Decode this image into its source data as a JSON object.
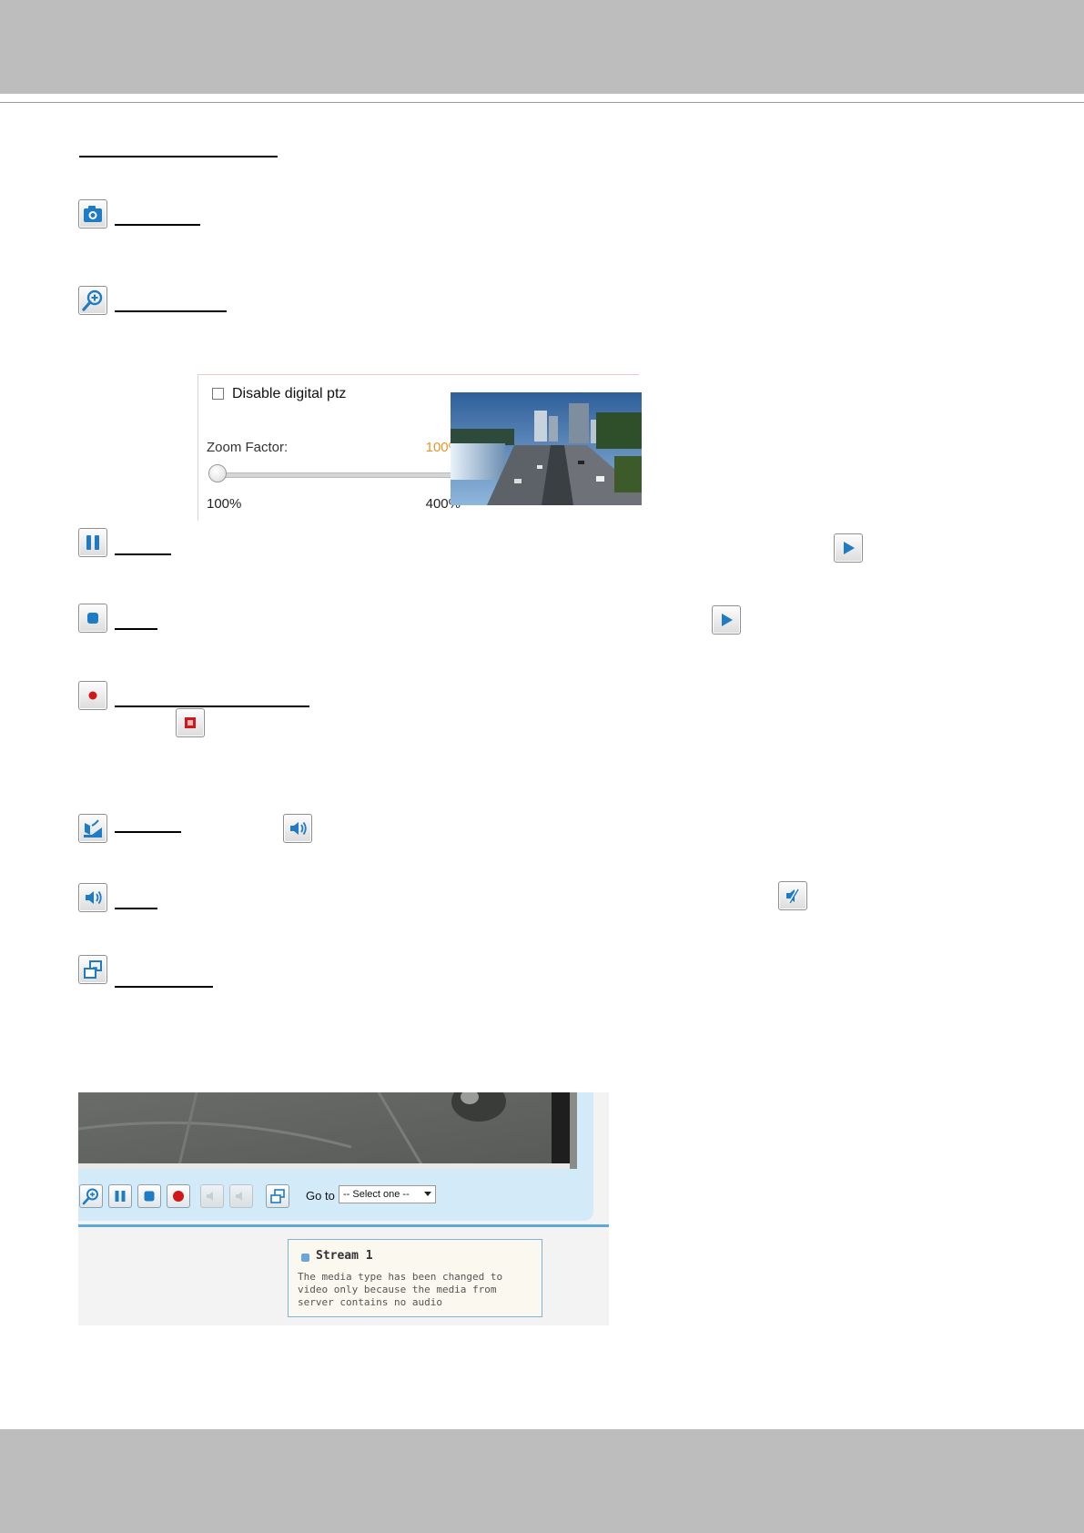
{
  "colors": {
    "header_gray": "#bdbdbd",
    "accent_orange": "#e8942a",
    "icon_blue": "#1e7bc4",
    "record_red": "#d01818",
    "panel_blue": "#d3ebf8"
  },
  "icons": {
    "snapshot": "camera-icon",
    "digital_zoom": "zoom-in-icon",
    "pause": "pause-icon",
    "play": "play-icon",
    "stop": "stop-icon",
    "record": "record-icon",
    "stop_record": "stop-record-icon",
    "volume": "volume-icon",
    "mute": "mute-icon",
    "talk": "talk-icon",
    "fullscreen": "fullscreen-icon"
  },
  "zoom_panel": {
    "checkbox_label": "Disable digital ptz",
    "zoom_factor_label": "Zoom Factor:",
    "zoom_factor_value": "100%",
    "slider_min_label": "100%",
    "slider_max_label": "400%",
    "slider_value_percent": 100
  },
  "player": {
    "goto_label": "Go to",
    "goto_selected": "-- Select one --",
    "stream_title": "Stream 1",
    "stream_message": "The media type has been changed to video only because the media from server contains no audio"
  }
}
